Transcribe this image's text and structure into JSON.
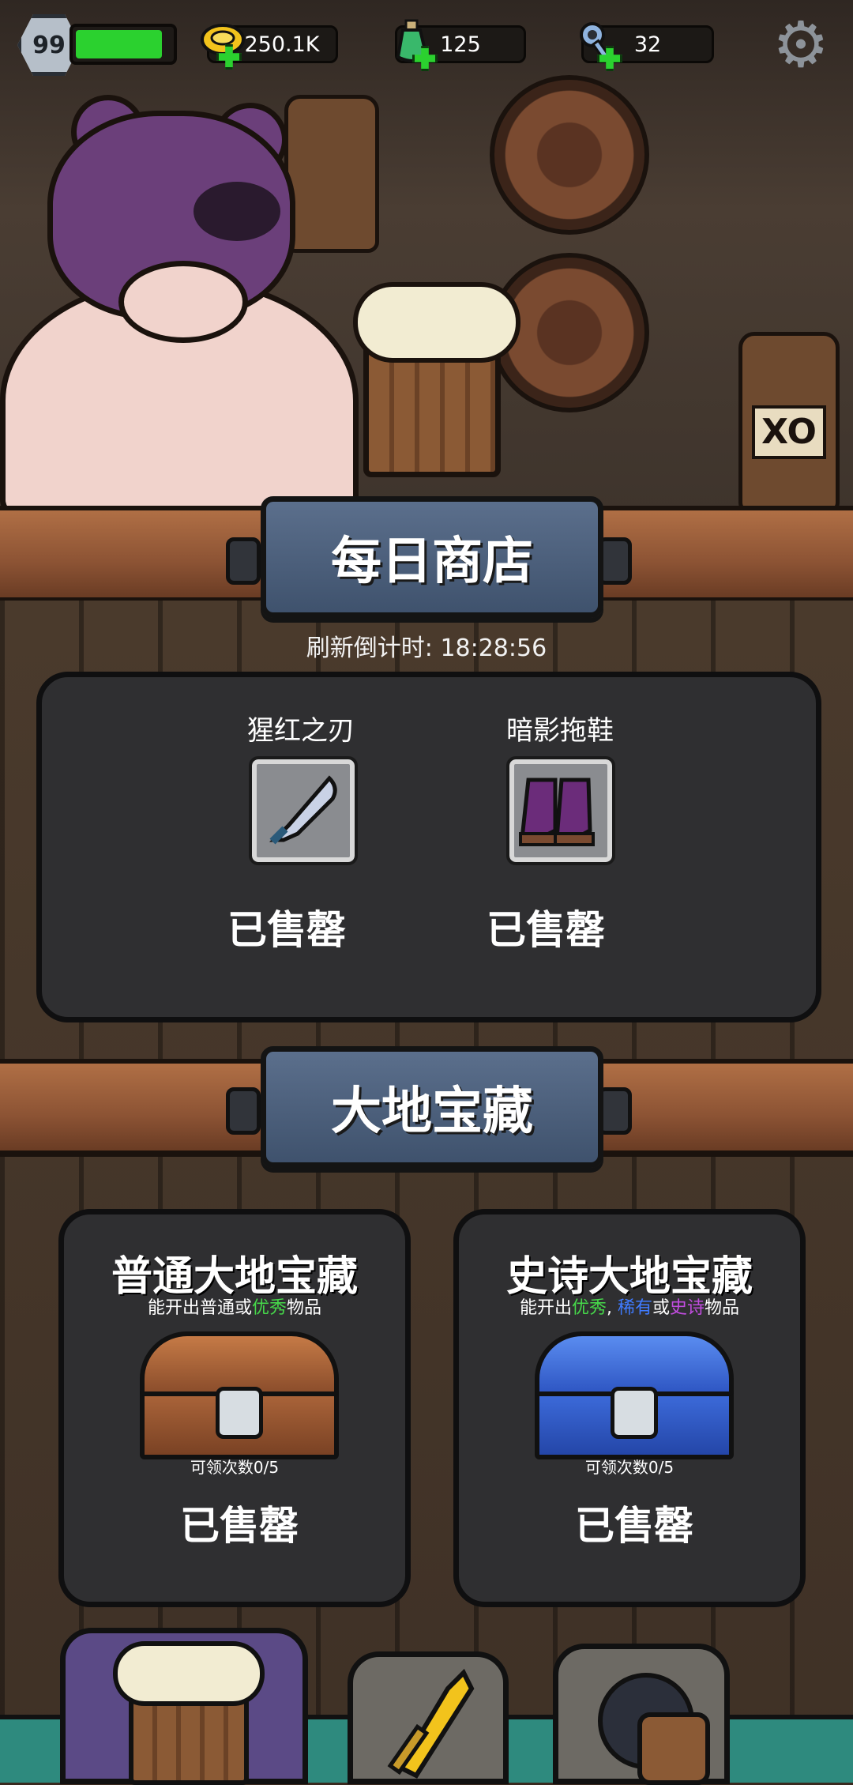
{
  "topbar": {
    "level": "99",
    "level_progress": 0.85,
    "gold": "250.1K",
    "potion": "125",
    "key": "32"
  },
  "icons": {
    "settings": "gear-icon",
    "gold": "gold-coin-icon",
    "potion": "potion-icon",
    "key": "key-icon"
  },
  "daily_shop": {
    "title": "每日商店",
    "countdown": "刷新倒计时:  18:28:56",
    "items": [
      {
        "name": "猩红之刃",
        "status": "已售罄",
        "icon": "blade-icon"
      },
      {
        "name": "暗影拖鞋",
        "status": "已售罄",
        "icon": "boots-icon"
      }
    ]
  },
  "treasure": {
    "title": "大地宝藏",
    "chests": [
      {
        "title": "普通大地宝藏",
        "desc_pre": "能开出普通或",
        "desc_hl1": "优秀",
        "desc_post": "物品",
        "count": "可领次数0/5",
        "status": "已售罄"
      },
      {
        "title": "史诗大地宝藏",
        "desc_pre": "能开出",
        "desc_hl1": "优秀",
        "desc_sep": ", ",
        "desc_hl2": "稀有",
        "desc_or": "或",
        "desc_hl3": "史诗",
        "desc_post": "物品",
        "count": "可领次数0/5",
        "status": "已售罄"
      }
    ]
  },
  "colors": {
    "accent_green": "#2bd12f",
    "rarity_good": "#46d84a",
    "rarity_rare": "#3f7bff",
    "rarity_epic": "#c24de0"
  }
}
